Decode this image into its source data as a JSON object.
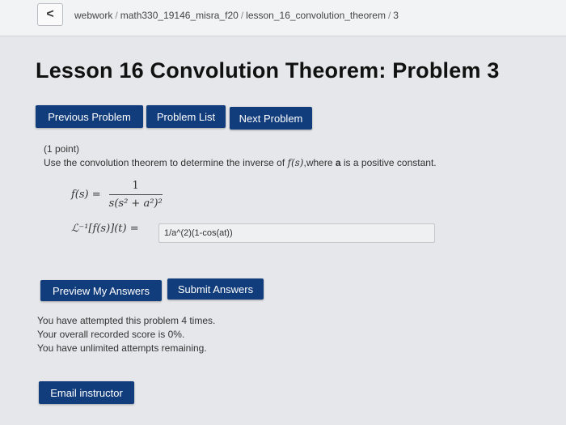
{
  "header": {
    "back_label": "<",
    "breadcrumb": [
      "webwork",
      "math330_19146_misra_f20",
      "lesson_16_convolution_theorem",
      "3"
    ],
    "separator": "/"
  },
  "page": {
    "title": "Lesson 16 Convolution Theorem: Problem 3"
  },
  "nav": {
    "previous": "Previous Problem",
    "list": "Problem List",
    "next": "Next Problem"
  },
  "problem": {
    "points": "(1 point)",
    "intro_before": "Use the convolution theorem to determine the inverse of",
    "intro_f": "f(s)",
    "intro_middle": ",where",
    "intro_var": "a",
    "intro_after": "is a positive constant.",
    "lhs": "f(s) =",
    "numerator": "1",
    "denominator": "s(s² + a²)²",
    "answer_label": "ℒ⁻¹[f(s)](t) =",
    "answer_value": "1/a^(2)(1-cos(at))"
  },
  "actions": {
    "preview": "Preview My Answers",
    "submit": "Submit Answers",
    "email": "Email instructor"
  },
  "status": {
    "attempts": "You have attempted this problem 4 times.",
    "score": "Your overall recorded score is 0%.",
    "remaining": "You have unlimited attempts remaining."
  },
  "colors": {
    "button": "#123d7c",
    "background": "#e6e7ea"
  }
}
